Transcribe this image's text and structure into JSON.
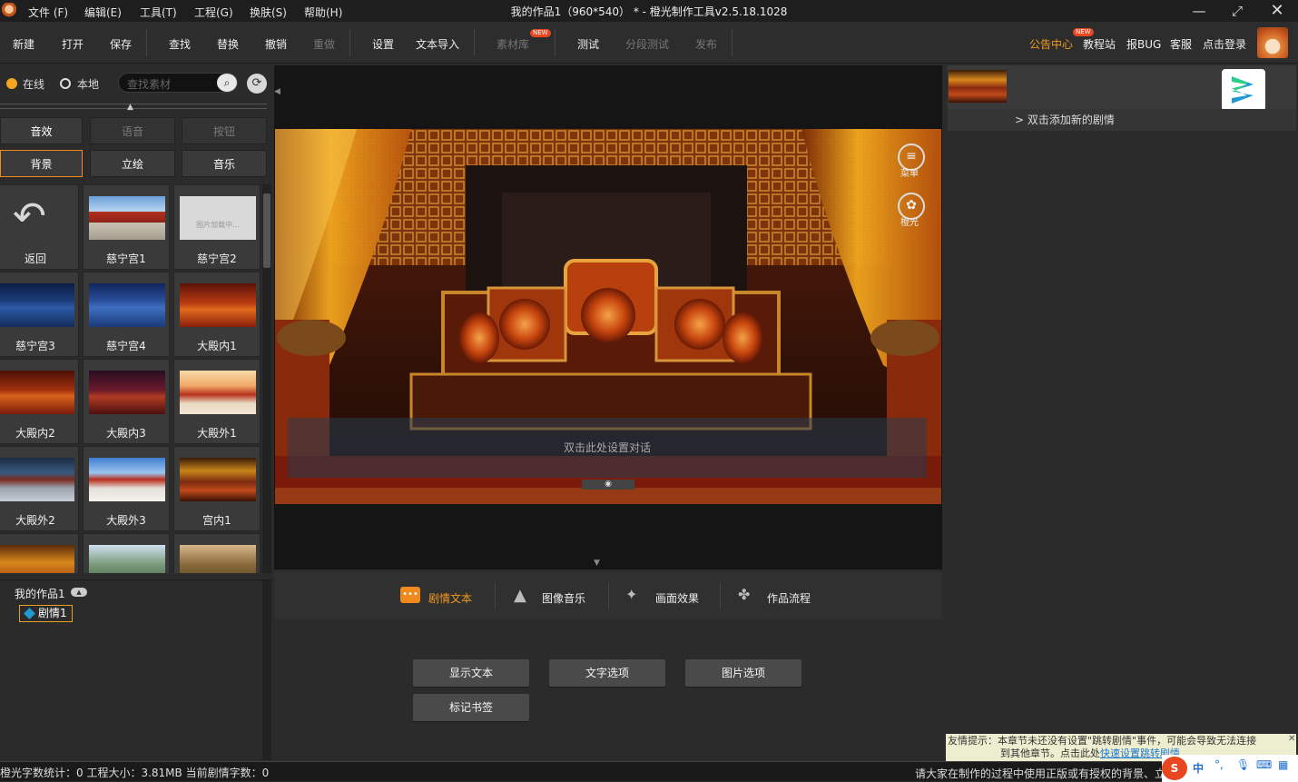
{
  "titlebar": {
    "menus": [
      "文件 (F)",
      "编辑(E)",
      "工具(T)",
      "工程(G)",
      "换肤(S)",
      "帮助(H)"
    ],
    "title": "我的作品1（960*540） * - 橙光制作工具v2.5.18.1028",
    "window_buttons": [
      "minimize-icon",
      "restore-icon",
      "close-icon"
    ]
  },
  "toolbar": {
    "new": "新建",
    "open": "打开",
    "save": "保存",
    "find": "查找",
    "replace": "替换",
    "undo": "撤销",
    "redo": "重做",
    "settings": "设置",
    "text_import": "文本导入",
    "library": "素材库",
    "new_badge": "NEW",
    "test": "测试",
    "segment_test": "分段测试",
    "publish": "发布",
    "notice": "公告中心",
    "tutorial": "教程站",
    "report_bug": "报BUG",
    "service": "客服",
    "login": "点击登录"
  },
  "left": {
    "online": "在线",
    "local": "本地",
    "search_placeholder": "查找素材",
    "tabs_row1": [
      "音效",
      "语音",
      "按钮"
    ],
    "tabs_row2": [
      "背景",
      "立绘",
      "音乐"
    ],
    "loading": "图片加载中...",
    "assets": [
      {
        "label": "返回"
      },
      {
        "label": "慈宁宫1"
      },
      {
        "label": "慈宁宫2"
      },
      {
        "label": "慈宁宫3"
      },
      {
        "label": "慈宁宫4"
      },
      {
        "label": "大殿内1"
      },
      {
        "label": "大殿内2"
      },
      {
        "label": "大殿内3"
      },
      {
        "label": "大殿外1"
      },
      {
        "label": "大殿外2"
      },
      {
        "label": "大殿外3"
      },
      {
        "label": "宫内1"
      },
      {
        "label": ""
      },
      {
        "label": ""
      },
      {
        "label": ""
      }
    ]
  },
  "project": {
    "name": "我的作品1",
    "chapter": "剧情1"
  },
  "stage": {
    "dialog_hint": "双击此处设置对话",
    "menu": "菜单",
    "orange": "橙光"
  },
  "bottom_tabs": {
    "story": "剧情文本",
    "image_music": "图像音乐",
    "effects": "画面效果",
    "flow": "作品流程"
  },
  "buttons": {
    "show_text": "显示文本",
    "text_options": "文字选项",
    "image_options": "图片选项",
    "bookmark": "标记书签"
  },
  "right": {
    "add_story": "> 双击添加新的剧情",
    "tip_line1": "友情提示：本章节未还没有设置\"跳转剧情\"事件，可能会导致无法连接",
    "tip_line2": "到其他章节。点击此处",
    "tip_link": "快速设置跳转剧情"
  },
  "status": {
    "left": "橙光字数统计：0 工程大小：3.81MB 当前剧情字数：0",
    "right": "请大家在制作的过程中使用正版或有授权的背景、立",
    "ime": "中"
  },
  "colors": {
    "accent": "#f08a1c",
    "bg": "#2b2b2b"
  }
}
